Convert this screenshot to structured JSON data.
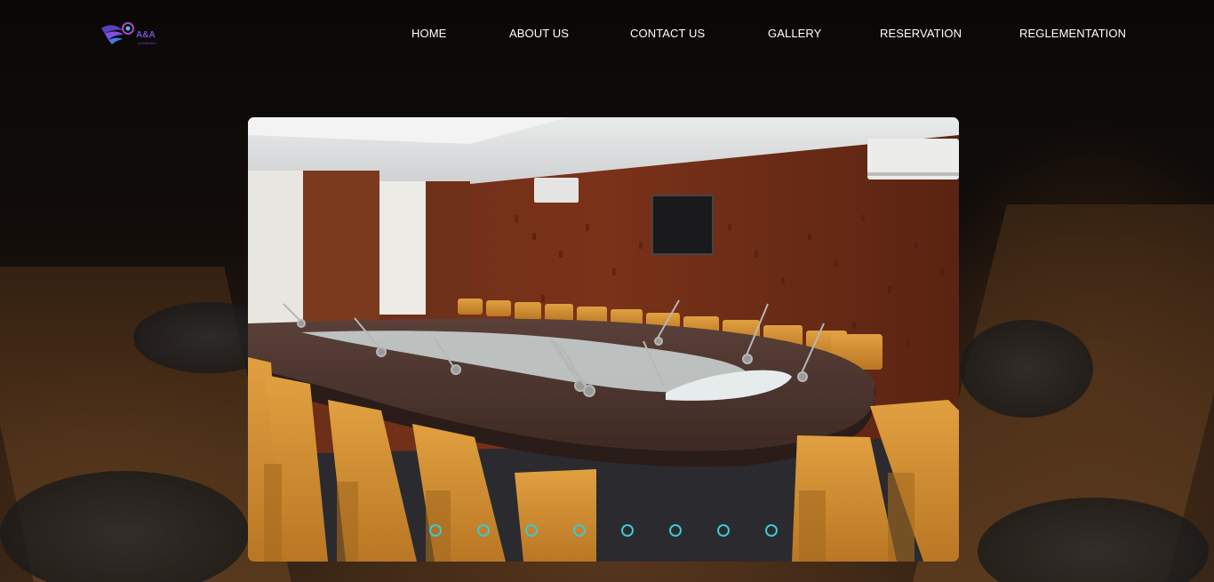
{
  "brand": {
    "logo_text": "A&A",
    "logo_subtext": "COMPANY",
    "accent_color": "#7b4fd0",
    "icon": "wing-logo-icon"
  },
  "nav": {
    "items": [
      {
        "label": "HOME"
      },
      {
        "label": "ABOUT US"
      },
      {
        "label": "CONTACT US"
      },
      {
        "label": "GALLERY"
      },
      {
        "label": "RESERVATION"
      },
      {
        "label": "REGLEMENTATION"
      }
    ]
  },
  "slider": {
    "dot_color": "#3fc6d8",
    "slide_count": 8,
    "image_subject": "conference room with U-shaped table and orange chairs"
  }
}
